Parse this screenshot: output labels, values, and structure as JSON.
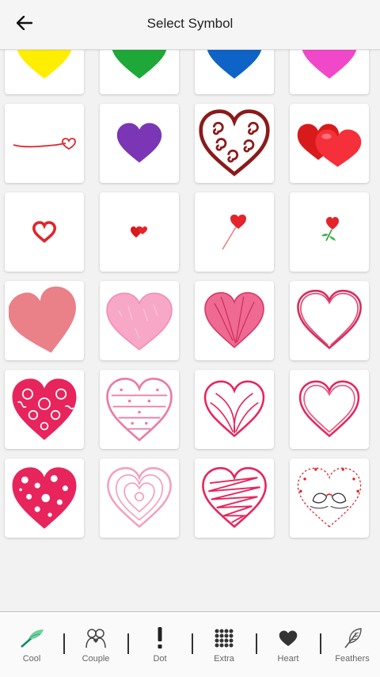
{
  "header": {
    "title": "Select Symbol",
    "back_icon": "arrow-left-icon"
  },
  "colors": {
    "pink": "#e8245c",
    "light_pink": "#f2a3c2",
    "red": "#e4232b",
    "dark_red": "#8b1a1a"
  },
  "symbols": [
    [
      "heart-yellow",
      "heart-green",
      "heart-blue",
      "heart-magenta"
    ],
    [
      "heart-line-red",
      "heart-purple",
      "heart-swirl-darkred",
      "hearts-double-3d"
    ],
    [
      "heart-outline-small",
      "hearts-pair-tiny",
      "heart-lollipop",
      "heart-rose"
    ],
    [
      "heart-tilted-salmon",
      "heart-sketch-lightpink",
      "heart-scribble-pink",
      "heart-outline-sketch"
    ],
    [
      "heart-floral-doodle",
      "heart-dots-stripes",
      "heart-loops",
      "heart-double-outline"
    ],
    [
      "heart-polka-dots",
      "heart-spiral-lines",
      "heart-zigzag",
      "heart-lovebirds-wreath"
    ]
  ],
  "tabs": [
    {
      "label": "Cool",
      "icon": "feather-quill-icon"
    },
    {
      "label": "Couple",
      "icon": "couple-icon"
    },
    {
      "label": "Dot",
      "icon": "exclamation-icon"
    },
    {
      "label": "Extra",
      "icon": "dot-grid-icon"
    },
    {
      "label": "Heart",
      "icon": "heart-icon"
    },
    {
      "label": "Feathers",
      "icon": "feather-icon"
    }
  ]
}
